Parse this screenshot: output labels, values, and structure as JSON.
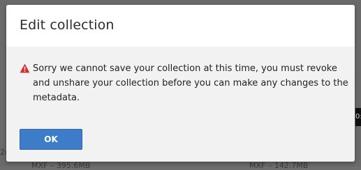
{
  "dialog": {
    "title": "Edit collection",
    "message": "Sorry we cannot save your collection at this time, you must revoke and unshare your collection before you can make any changes to the metadata.",
    "ok_label": "OK",
    "warning_icon": "warning-triangle-icon",
    "ok_color": "#3d7cc9",
    "warning_color": "#d32f2f"
  },
  "background": {
    "left_fragment": "2(",
    "left_size": "MXF – 395.6MB",
    "right_size": "MXF – 142.7MB",
    "right_chip": "0:"
  }
}
